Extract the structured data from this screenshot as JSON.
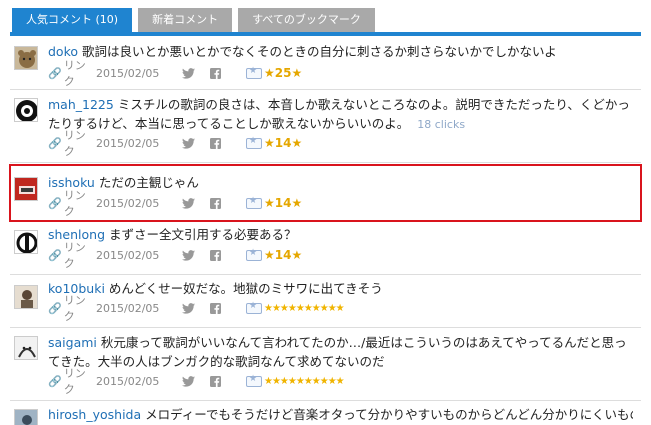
{
  "tabs": [
    {
      "label": "人気コメント (10)"
    },
    {
      "label": "新着コメント"
    },
    {
      "label": "すべてのブックマーク"
    }
  ],
  "meta_labels": {
    "link": "リンク"
  },
  "comments": [
    {
      "user": "doko",
      "text": "歌詞は良いとか悪いとかでなくそのときの自分に刺さるか刺さらないかでしかないよ",
      "date": "2015/02/05",
      "stars": "★25★"
    },
    {
      "user": "mah_1225",
      "text": "ミスチルの歌詞の良さは、本音しか歌えないところなのよ。説明できただったり、くどかったりするけど、本当に思ってることしか歌えないからいいのよ。",
      "clicks": "18 clicks",
      "date": "2015/02/05",
      "stars": "★14★"
    },
    {
      "user": "isshoku",
      "text": "ただの主観じゃん",
      "date": "2015/02/05",
      "stars": "★14★"
    },
    {
      "user": "shenlong",
      "text": "まずさー全文引用する必要ある？",
      "date": "2015/02/05",
      "stars": "★14★"
    },
    {
      "user": "ko10buki",
      "text": "めんどくせー奴だな。地獄のミサワに出てきそう",
      "date": "2015/02/05",
      "stars": "★★★★★★★★★★"
    },
    {
      "user": "saigami",
      "text": "秋元康って歌詞がいいなんて言われてたのか…/最近はこういうのはあえてやってるんだと思ってきた。大半の人はブンガク的な歌詞なんて求めてないのだ",
      "date": "2015/02/05",
      "stars": "★★★★★★★★★★"
    },
    {
      "user": "hirosh_yoshida",
      "text": "メロディーでもそうだけど音楽オタって分かりやすいものからどんどん分かりにくいものに流"
    }
  ]
}
